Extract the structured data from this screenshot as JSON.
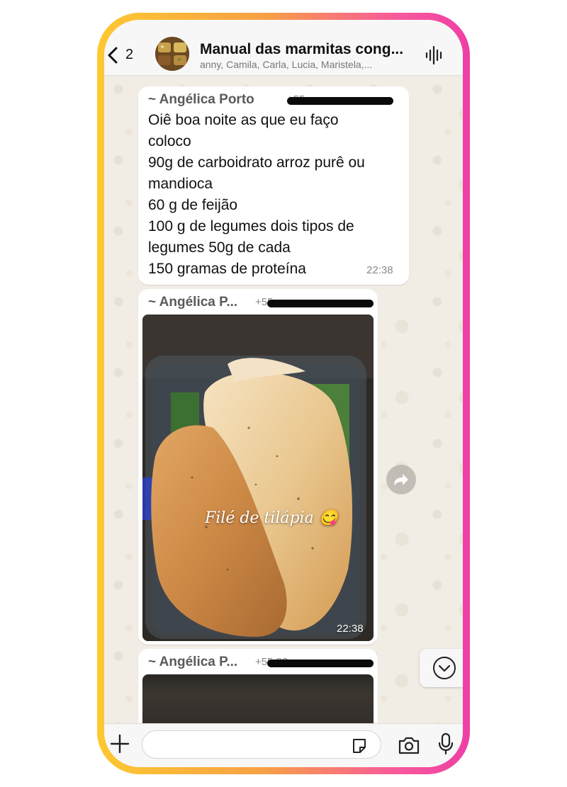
{
  "header": {
    "back_count": "2",
    "title": "Manual das marmitas cong...",
    "subtitle": "anny, Camila, Carla, Lucia, Maristela,..."
  },
  "messages": [
    {
      "sender": "~ Angélica Porto",
      "phone_partial": "+55 ",
      "lines": [
        "Oiê boa noite as que eu faço",
        "coloco",
        "90g de carboidrato arroz  purê ou",
        "mandioca",
        "60 g de feijão",
        "100 g de legumes dois tipos de",
        "legumes 50g de cada",
        "150 gramas de proteína"
      ],
      "time": "22:38"
    },
    {
      "sender": "~ Angélica P...",
      "phone_partial": "+55",
      "caption": "Filé de tilápia 😋",
      "time": "22:38"
    },
    {
      "sender": "~ Angélica P...",
      "phone_partial": "+55 82"
    }
  ],
  "colors": {
    "frame_gradient_start": "#fdc830",
    "frame_gradient_end": "#ee3fa5",
    "chat_background": "#f2ede4",
    "bubble": "#ffffff"
  },
  "icons": {
    "back": "chevron-left-icon",
    "wave": "audio-wave-icon",
    "forward": "forward-arrow-icon",
    "scroll_down": "chevron-down-circle-icon",
    "plus": "plus-icon",
    "sticker": "sticker-icon",
    "camera": "camera-icon",
    "mic": "microphone-icon"
  }
}
